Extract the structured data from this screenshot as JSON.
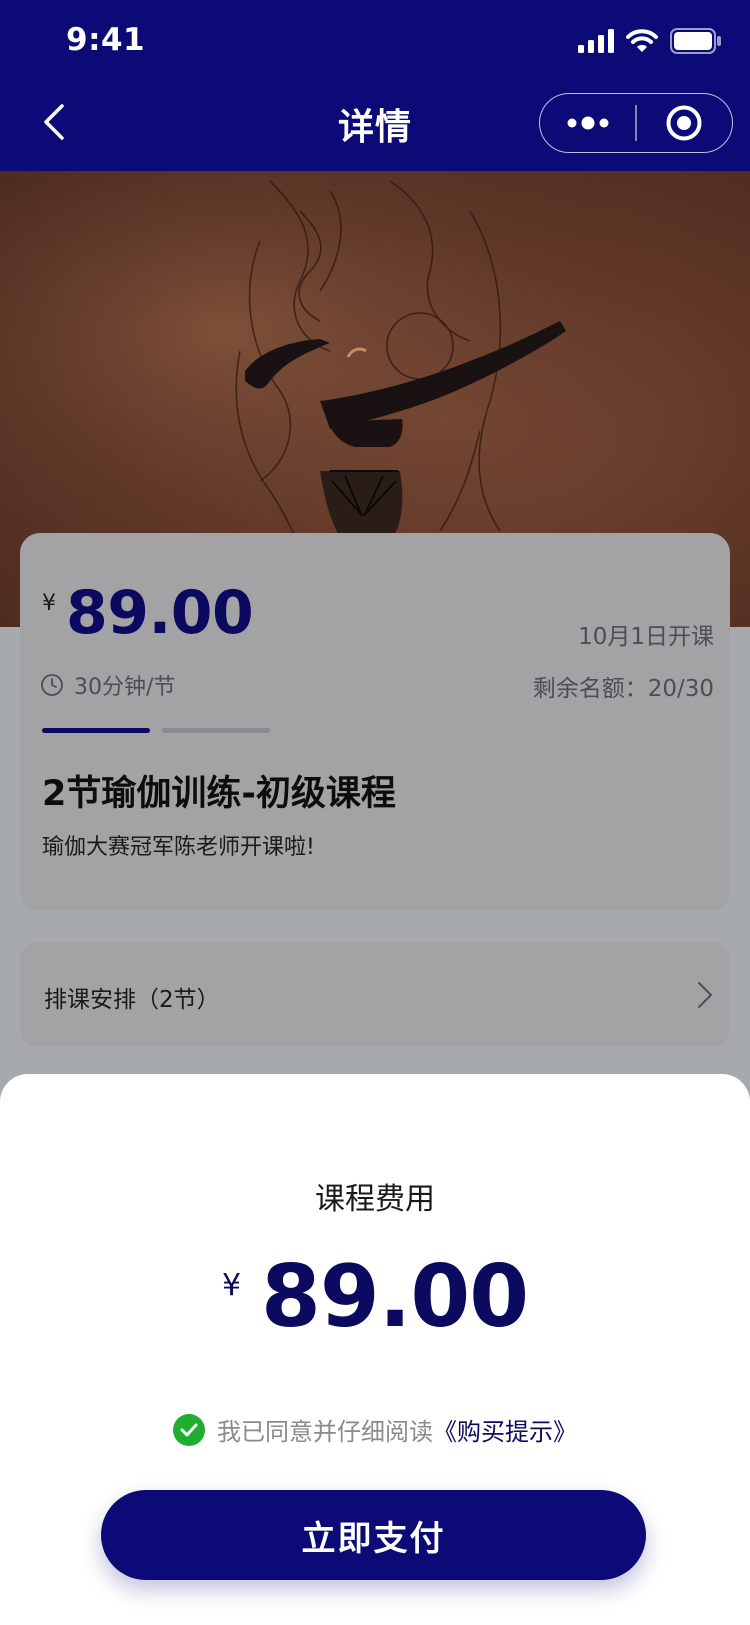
{
  "status_bar": {
    "time": "9:41"
  },
  "nav": {
    "title": "详情"
  },
  "course": {
    "currency": "¥",
    "price": "89.00",
    "start_date": "10月1日开课",
    "duration": "30分钟/节",
    "quota": "剩余名额：20/30",
    "title": "2节瑜伽训练-初级课程",
    "subtitle": "瑜伽大赛冠军陈老师开课啦!",
    "carousel": {
      "total": 2,
      "active": 1
    }
  },
  "schedule": {
    "label": "排课安排（2节）"
  },
  "sheet": {
    "title": "课程费用",
    "currency": "¥",
    "price": "89.00",
    "agree_text": "我已同意并仔细阅读",
    "agree_link": "《购买提示》",
    "agreed": true,
    "pay_button": "立即支付"
  },
  "colors": {
    "brand": "#0b0a77",
    "price": "#0b0a5e",
    "check": "#1fae2f"
  },
  "icons": [
    "signal-icon",
    "wifi-icon",
    "battery-icon",
    "back-icon",
    "more-icon",
    "target-icon",
    "clock-icon",
    "chevron-right-icon",
    "check-icon"
  ]
}
